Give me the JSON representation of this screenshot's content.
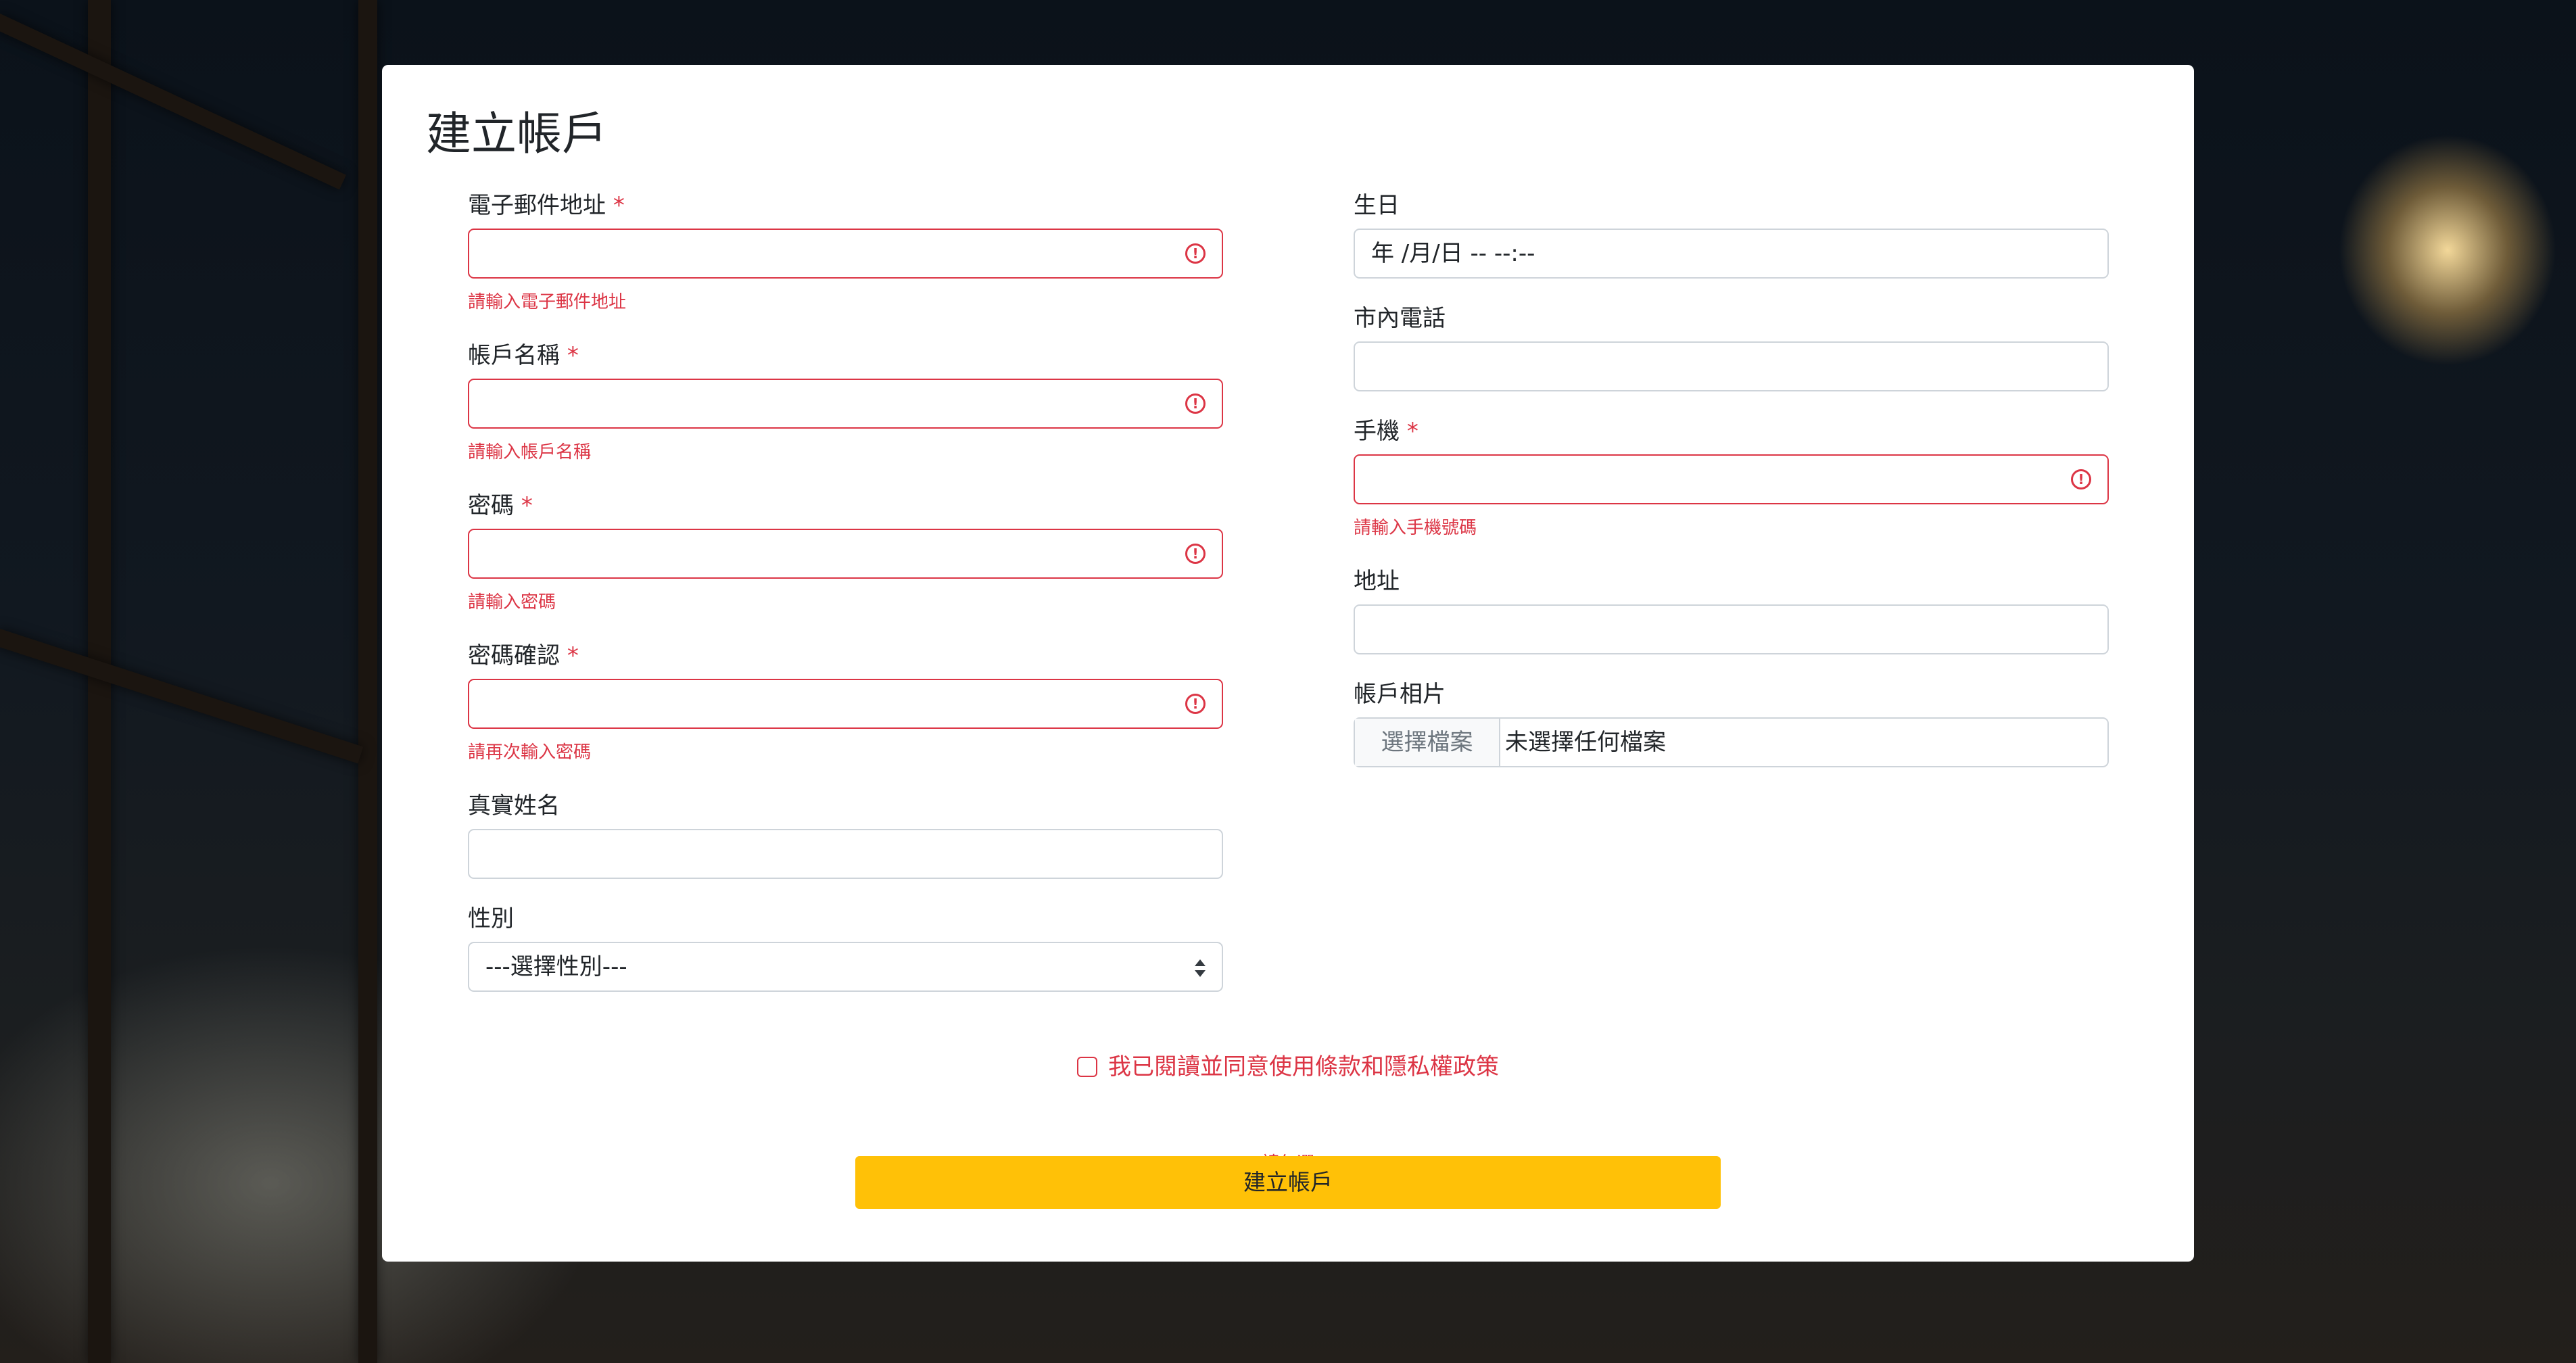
{
  "form_title": "建立帳戶",
  "fields": {
    "email": {
      "label": "電子郵件地址",
      "required_mark": "*",
      "value": "",
      "feedback": "請輸入電子郵件地址"
    },
    "account_name": {
      "label": "帳戶名稱",
      "required_mark": "*",
      "value": "",
      "feedback": "請輸入帳戶名稱"
    },
    "password": {
      "label": "密碼",
      "required_mark": "*",
      "value": "",
      "feedback": "請輸入密碼"
    },
    "password_confirm": {
      "label": "密碼確認",
      "required_mark": "*",
      "value": "",
      "feedback": "請再次輸入密碼"
    },
    "real_name": {
      "label": "真實姓名",
      "value": ""
    },
    "gender": {
      "label": "性別",
      "selected": "---選擇性別---"
    },
    "birthday": {
      "label": "生日",
      "value": "年 /月/日 -- --:--"
    },
    "landline": {
      "label": "市內電話",
      "value": ""
    },
    "mobile": {
      "label": "手機",
      "required_mark": "*",
      "value": "",
      "feedback": "請輸入手機號碼"
    },
    "address": {
      "label": "地址",
      "value": ""
    },
    "photo": {
      "label": "帳戶相片",
      "button": "選擇檔案",
      "status": "未選擇任何檔案"
    }
  },
  "terms": {
    "label": "我已閱讀並同意使用條款和隱私權政策",
    "feedback": "請勾選",
    "checked": false
  },
  "submit_label": "建立帳戶",
  "icons": {
    "invalid": "exclamation-circle-icon",
    "select": "sort-arrows-icon"
  },
  "colors": {
    "danger": "#dc3545",
    "warning": "#ffc107",
    "border": "#ced4da",
    "text": "#212529"
  }
}
